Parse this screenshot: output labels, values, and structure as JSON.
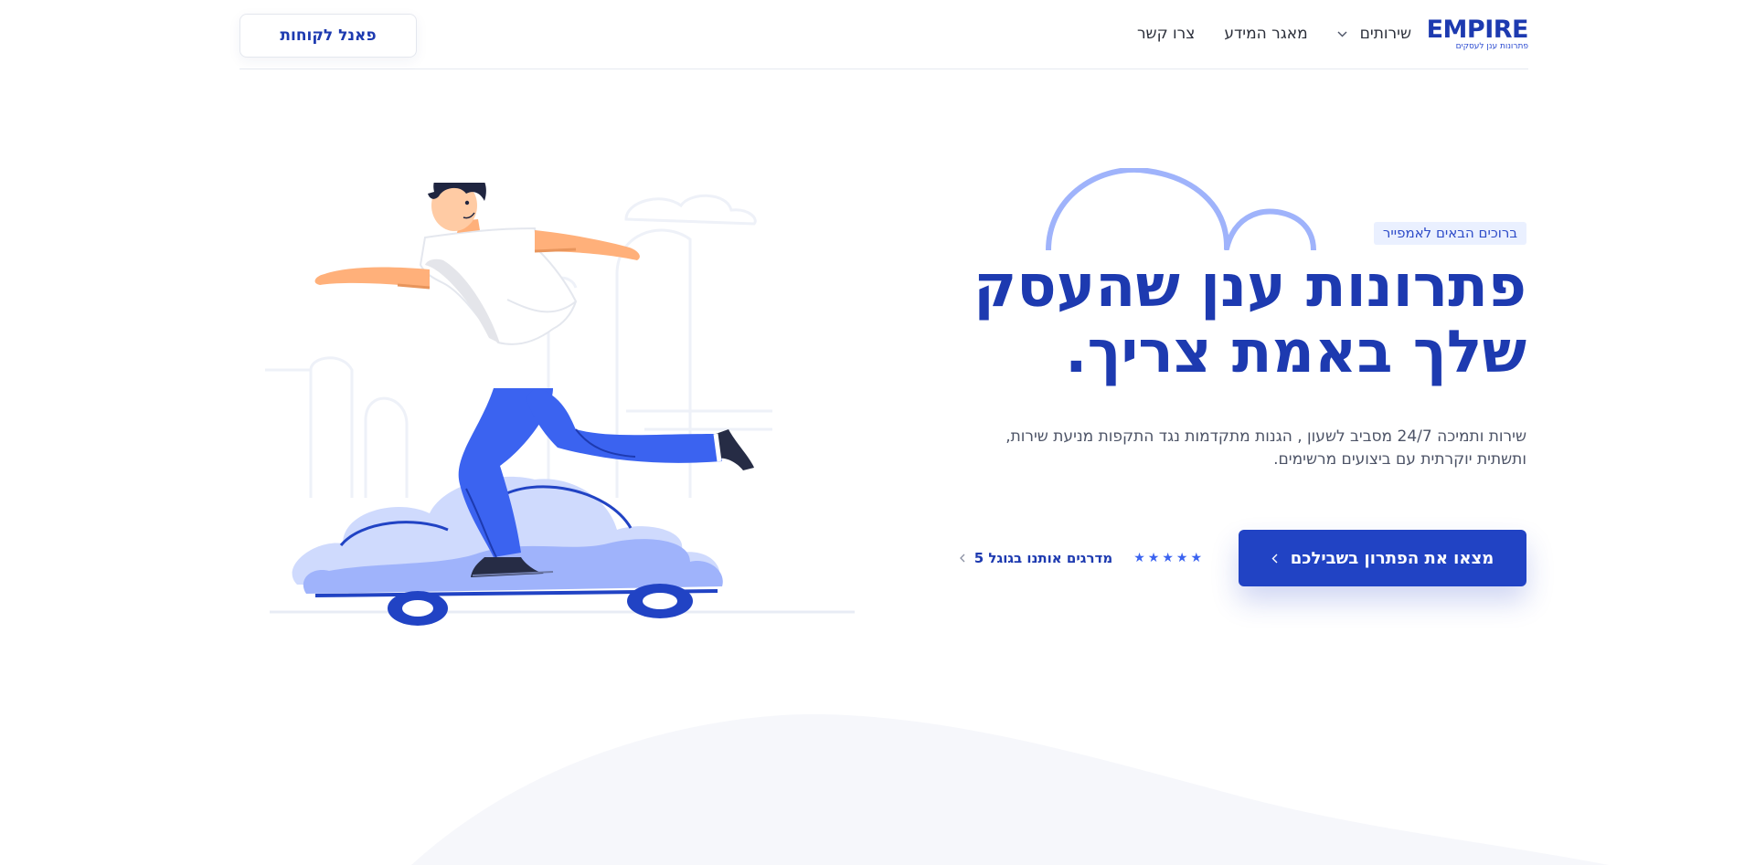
{
  "brand": {
    "name": "EMPIRE",
    "tagline": "פתרונות ענן לעסקים",
    "primary_color": "#1d3ab0",
    "accent_color": "#3b63f0"
  },
  "nav": {
    "items": [
      {
        "label": "שירותים",
        "has_dropdown": true,
        "icon": "chevron-down-icon"
      },
      {
        "label": "מאגר המידע",
        "has_dropdown": false
      },
      {
        "label": "צרו קשר",
        "has_dropdown": false
      }
    ],
    "client_panel_label": "פאנל לקוחות"
  },
  "hero": {
    "badge": "ברוכים הבאים לאמפייר",
    "headline_line1": "פתרונות ענן שהעסק",
    "headline_line2": "שלך באמת צריך.",
    "description": "שירות ותמיכה 24/7 מסביב לשעון , הגנות מתקדמות נגד התקפות מניעת שירות, ותשתית יוקרתית עם ביצועים מרשימים.",
    "cta_label": "מצאו את הפתרון בשבילכם",
    "cta_icon": "chevron-left-icon",
    "rating_stars": 5,
    "rating_text": "מדרגים אותנו בגוגל 5",
    "rating_icon": "chevron-left-icon"
  },
  "illustration": {
    "subject": "person-on-skateboard",
    "colors": {
      "pants": "#3b63f0",
      "board": "#2143c4",
      "cloud_light": "#cfdafd",
      "cloud_mid": "#9fb3fb",
      "skin": "#ffb07a",
      "hair": "#1f2540"
    }
  }
}
